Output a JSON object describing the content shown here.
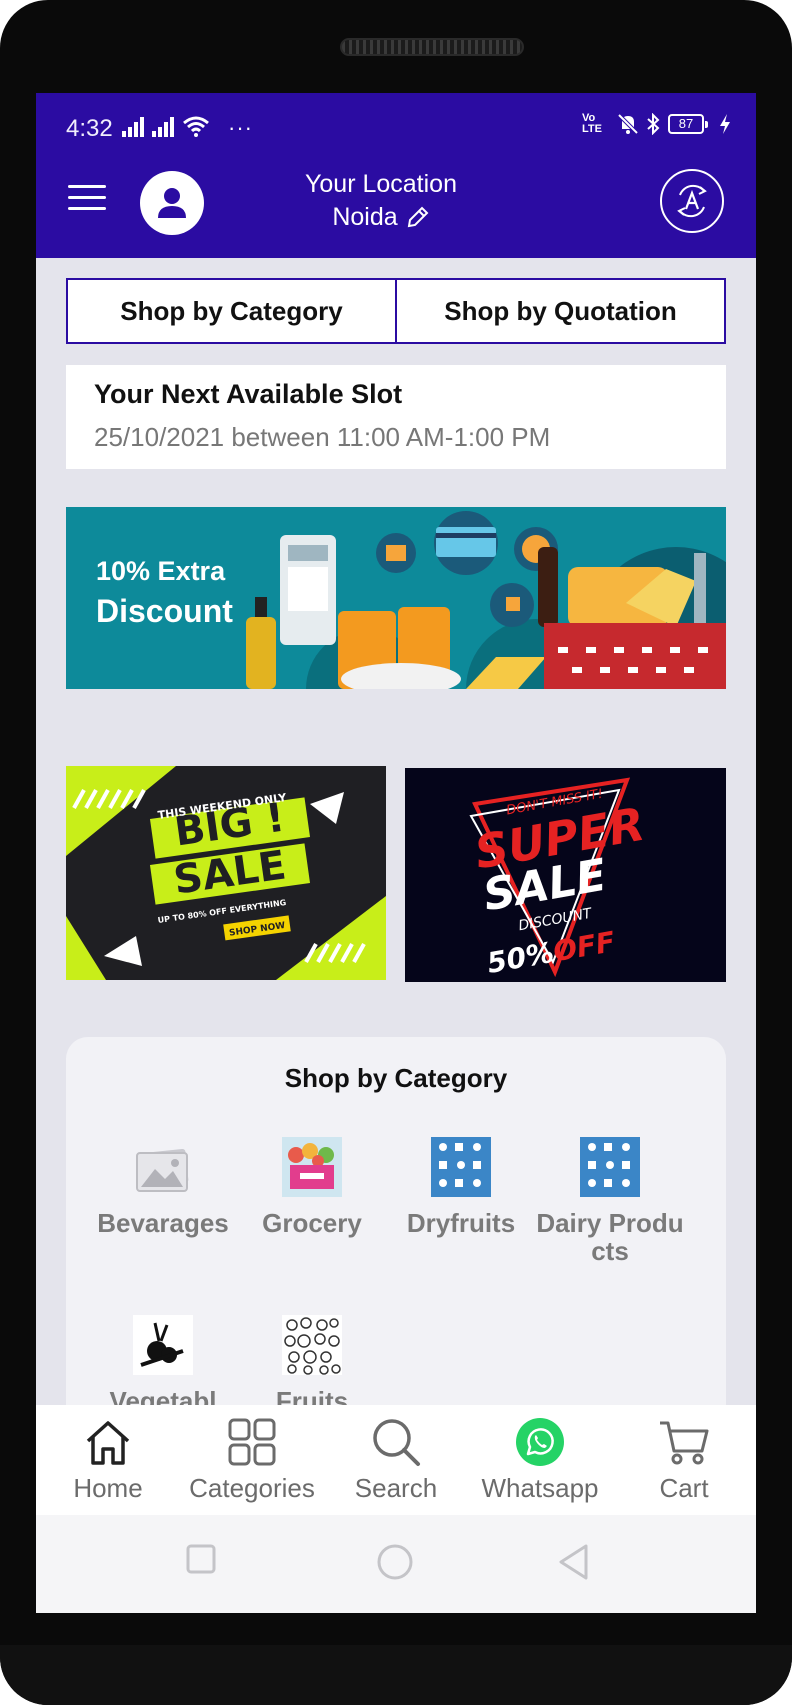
{
  "status_bar": {
    "time": "4:32",
    "battery": "87",
    "volte_label": "Vo LTE"
  },
  "header": {
    "location_label": "Your Location",
    "location_city": "Noida"
  },
  "tabs": [
    {
      "label": "Shop by Category"
    },
    {
      "label": "Shop by Quotation"
    }
  ],
  "slot": {
    "title": "Your Next Available Slot",
    "value": "25/10/2021 between 11:00 AM-1:00 PM"
  },
  "banners": {
    "discount": {
      "line1": "10% Extra",
      "line2": "Discount"
    },
    "big_sale": {
      "tagline": "THIS WEEKEND ONLY",
      "line1": "BIG !",
      "line2": "SALE",
      "sub": "UP TO 80% OFF EVERYTHING",
      "cta": "SHOP NOW"
    },
    "super_sale": {
      "tagline": "DON'T MISS IT!",
      "line1": "SUPER",
      "line2": "SALE",
      "sub": "DISCOUNT",
      "offer": "50%OFF"
    }
  },
  "category_section": {
    "title": "Shop by Category",
    "items": [
      {
        "label": "Bevarages",
        "icon": "image-placeholder-icon"
      },
      {
        "label": "Grocery",
        "icon": "grocery-thumbnail"
      },
      {
        "label": "Dryfruits",
        "icon": "dryfruits-thumbnail"
      },
      {
        "label": "Dairy Products",
        "icon": "dairy-thumbnail"
      },
      {
        "label": "Vegetabl",
        "icon": "vegetables-thumbnail"
      },
      {
        "label": "Fruits",
        "icon": "fruits-thumbnail"
      }
    ]
  },
  "bottom_nav": [
    {
      "label": "Home",
      "icon": "home-icon"
    },
    {
      "label": "Categories",
      "icon": "grid-icon"
    },
    {
      "label": "Search",
      "icon": "search-icon"
    },
    {
      "label": "Whatsapp",
      "icon": "whatsapp-icon"
    },
    {
      "label": "Cart",
      "icon": "cart-icon"
    }
  ],
  "colors": {
    "primary": "#2b0ca2",
    "background": "#e4e4ec",
    "whatsapp": "#25d366",
    "discount_banner": "#0d8a9a"
  }
}
